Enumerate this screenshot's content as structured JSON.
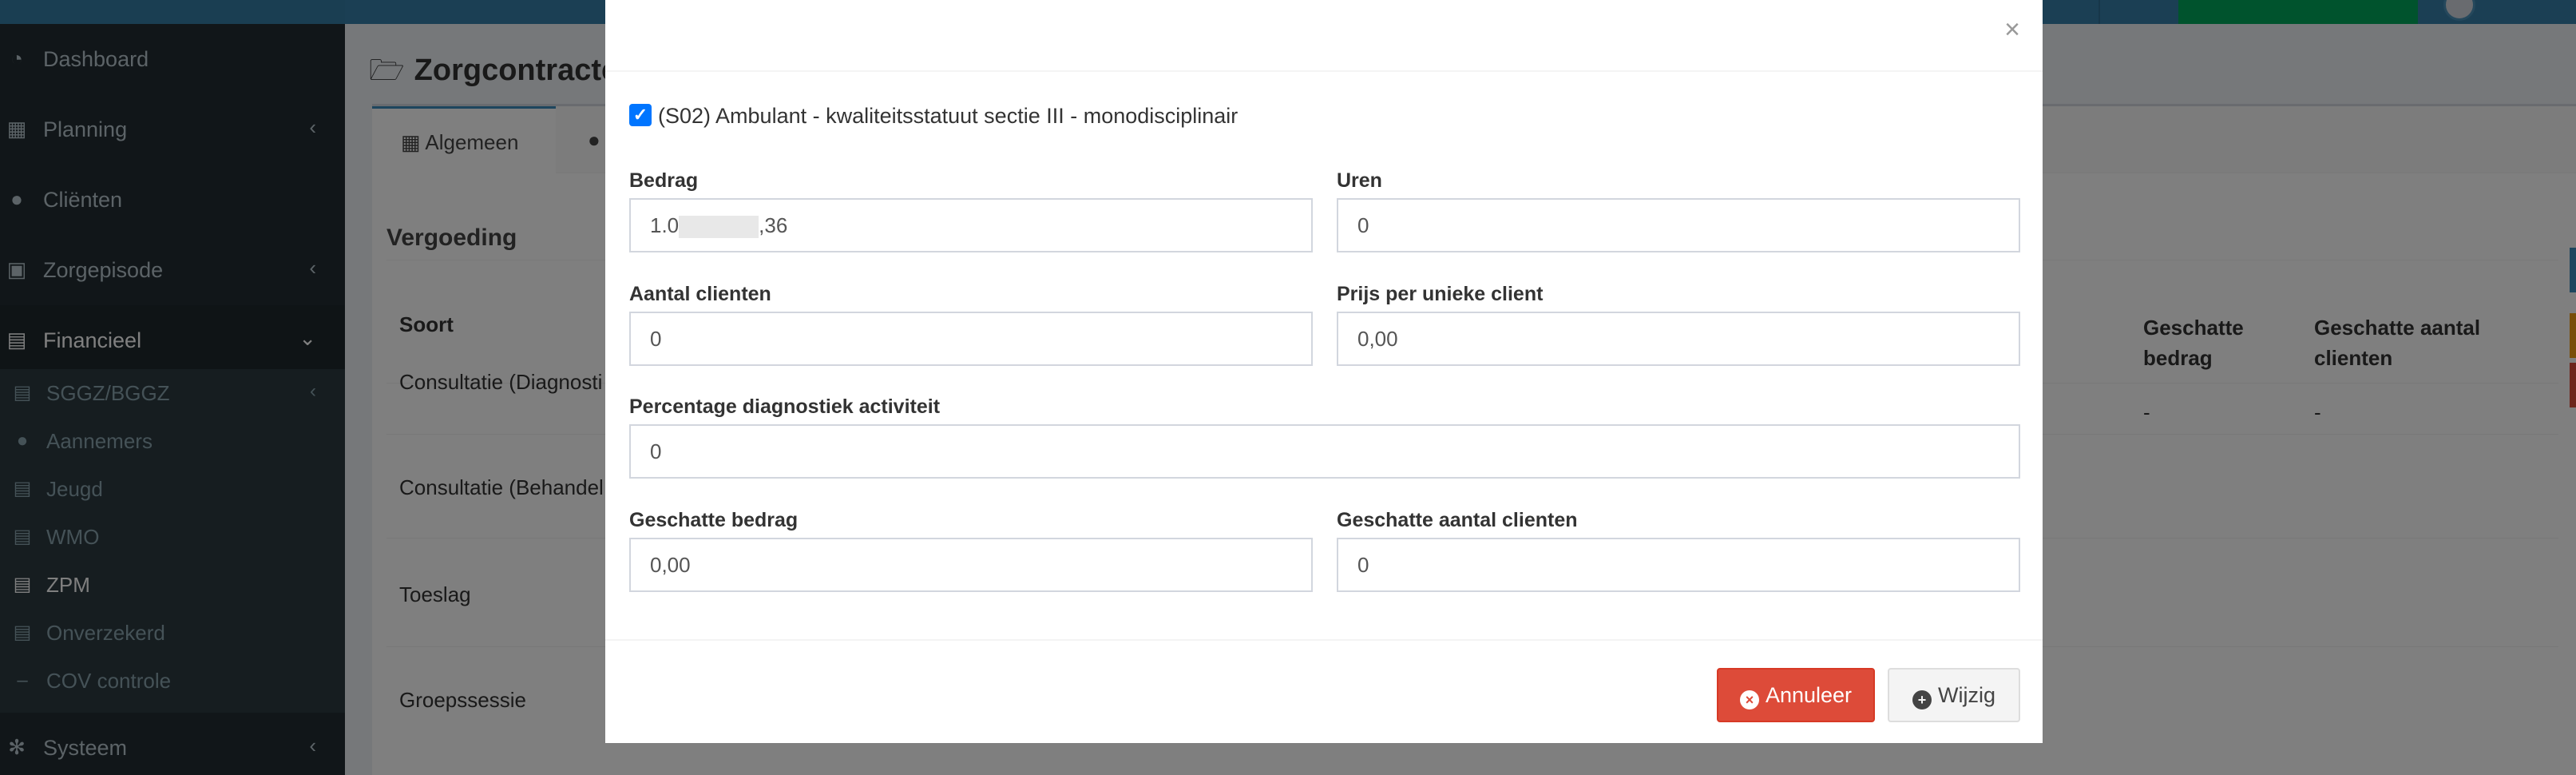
{
  "sidebar": {
    "items": [
      {
        "label": "Dashboard",
        "icon": "dashboard-icon"
      },
      {
        "label": "Planning",
        "icon": "calendar-icon"
      },
      {
        "label": "Cliënten",
        "icon": "user-icon"
      },
      {
        "label": "Zorgepisode",
        "icon": "medkit-icon"
      },
      {
        "label": "Financieel",
        "icon": "book-icon"
      },
      {
        "label": "Systeem",
        "icon": "gears-icon"
      }
    ],
    "financieel_sub": [
      {
        "label": "SGGZ/BGGZ",
        "icon": "book-icon"
      },
      {
        "label": "Aannemers",
        "icon": "users-icon"
      },
      {
        "label": "Jeugd",
        "icon": "book-icon"
      },
      {
        "label": "WMO",
        "icon": "book-icon"
      },
      {
        "label": "ZPM",
        "icon": "book-icon"
      },
      {
        "label": "Onverzekerd",
        "icon": "book-icon"
      },
      {
        "label": "COV controle",
        "icon": "minus-icon"
      }
    ]
  },
  "page": {
    "title": "Zorgcontracten",
    "tabs": [
      {
        "label": "Algemeen"
      }
    ],
    "section_title": "Vergoeding",
    "table": {
      "headers": [
        "Soort",
        "Geschatte bedrag",
        "Geschatte aantal clienten"
      ],
      "rows": [
        "Consultatie (Diagnosti",
        "Consultatie (Behandel",
        "Toeslag",
        "Groepssessie"
      ],
      "dash": "-"
    }
  },
  "colors": {
    "header_blue": "#3c8dbc",
    "sidebar_dark": "#222d32",
    "danger": "#dd4b39",
    "success": "#00a65a"
  },
  "modal": {
    "close_label": "×",
    "checkbox_label": "(S02) Ambulant - kwaliteitsstatuut sectie III - monodisciplinair",
    "checkbox_checked": true,
    "fields": {
      "bedrag": {
        "label": "Bedrag",
        "value_prefix": "1.0",
        "value_suffix": ",36"
      },
      "uren": {
        "label": "Uren",
        "value": "0"
      },
      "aantal_clienten": {
        "label": "Aantal clienten",
        "value": "0"
      },
      "prijs_per_client": {
        "label": "Prijs per unieke client",
        "value": "0,00"
      },
      "percentage": {
        "label": "Percentage diagnostiek activiteit",
        "value": "0"
      },
      "geschatte_bedrag": {
        "label": "Geschatte bedrag",
        "value": "0,00"
      },
      "geschatte_aantal": {
        "label": "Geschatte aantal clienten",
        "value": "0"
      }
    },
    "buttons": {
      "cancel": "Annuleer",
      "save": "Wijzig"
    }
  }
}
